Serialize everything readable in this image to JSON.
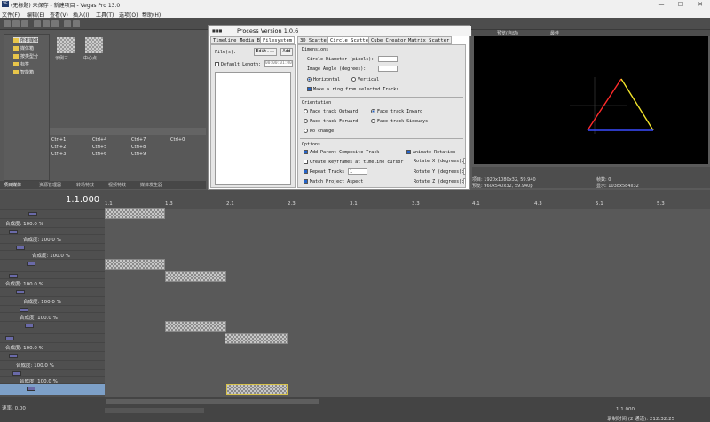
{
  "window": {
    "title": "(无标题) 未保存 - 新建项目 - Vegas Pro 13.0"
  },
  "menu": [
    "文件(F)",
    "编辑(E)",
    "查看(V)",
    "插入(I)",
    "工具(T)",
    "选项(O)",
    "帮助(H)"
  ],
  "explorer": {
    "tree": [
      "所有媒体",
      "媒体箱",
      "按类型分",
      "标签",
      "智能箱"
    ],
    "thumbs": [
      "示例三...",
      "中心点..."
    ],
    "shortcuts": [
      "Ctrl+1",
      "Ctrl+4",
      "Ctrl+7",
      "Ctrl+0",
      "Ctrl+2",
      "Ctrl+5",
      "Ctrl+8",
      "Ctrl+3",
      "Ctrl+6",
      "Ctrl+9"
    ],
    "tabs": [
      "项目媒体",
      "资源管理器",
      "转场特效",
      "视频特效",
      "媒体发生器"
    ]
  },
  "plugin": {
    "title": "Process  Version 1.0.6",
    "tabs_left": [
      "Timeline Media Bin",
      "Filesystem"
    ],
    "tabs_right": [
      "3D Scatter",
      "Circle Scatter",
      "Cube Creator",
      "Matrix Scatter"
    ],
    "file_label": "File(s):",
    "edit_btn": "Edit...",
    "add_btn": "Add",
    "default_length_label": "Default Length:",
    "default_length_value": "00:00:01:00",
    "dimensions_title": "Dimensions",
    "circle_diameter_label": "Circle Diameter (pixels):",
    "image_angle_label": "Image Angle (degrees):",
    "horizontal": "Horizontal",
    "vertical": "Vertical",
    "make_ring": "Make a ring from selected Tracks",
    "orientation_title": "Orientation",
    "face_outward": "Face track Outward",
    "face_inward": "Face track Inward",
    "face_forward": "Face track Forward",
    "face_sideways": "Face track Sideways",
    "no_change": "No change",
    "options_title": "Options",
    "add_parent": "Add Parent Composite Track",
    "animate_rotation": "Animate Rotation",
    "create_keyframes": "Create keyframes at timeline cursor",
    "rotate_x": "Rotate X (degrees):",
    "rotate_y": "Rotate Y (degrees):",
    "rotate_z": "Rotate Z (degrees):",
    "repeat_tracks": "Repeat Tracks",
    "repeat_value": "1",
    "match_aspect": "Match Project Aspect"
  },
  "preview": {
    "head_left": "预览(自动)",
    "head_right": "最佳",
    "project_label": "项目:",
    "project_value": "1920x1080x32, 59.940",
    "preview_label": "预览:",
    "preview_value": "960x540x32, 59.940p",
    "frame_label": "帧数:",
    "frame_value": "0",
    "display_label": "显示:",
    "display_value": "1038x584x32"
  },
  "timeline": {
    "timecode": "1.1.000",
    "ruler": [
      "1.1",
      "1.3",
      "2.1",
      "2.3",
      "3.1",
      "3.3",
      "4.1",
      "4.3",
      "5.1",
      "5.3"
    ],
    "level_prefix": "合成度:",
    "level_value": "100.0 %",
    "rate_label": "速率:",
    "rate_value": "0.00",
    "end_timecode": "1.1.000",
    "status": "录制时间 (2 通道): 212:32:25"
  }
}
